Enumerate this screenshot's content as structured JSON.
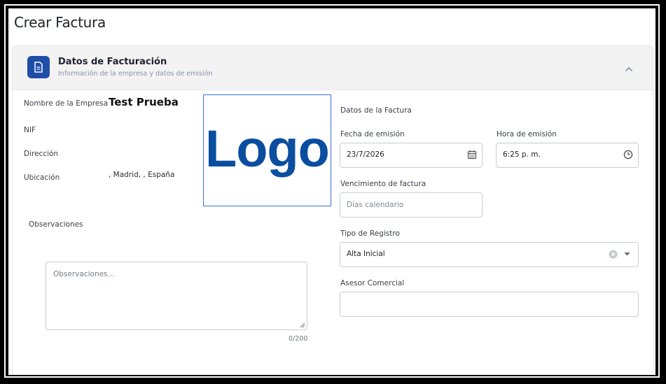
{
  "page": {
    "title": "Crear Factura"
  },
  "section": {
    "title": "Datos de Facturación",
    "subtitle": "Información de la empresa y datos de emisión",
    "icon": "document-icon",
    "collapse_icon": "chevron-up-icon"
  },
  "company": {
    "name_label": "Nombre de la Empresa",
    "name_value": "Test Prueba",
    "nif_label": "NIF",
    "address_label": "Dirección",
    "location_label": "Ubicación",
    "location_value": ", Madrid, , España",
    "logo_text": "Logo"
  },
  "observations": {
    "label": "Observaciones",
    "placeholder": "Observaciones...",
    "counter": "0/200"
  },
  "invoice": {
    "section_label": "Datos de la Factura",
    "issue_date_label": "Fecha de emisión",
    "issue_date_value": "23/7/2026",
    "issue_time_label": "Hora de emisión",
    "issue_time_value": "6:25 p. m.",
    "due_label": "Vencimiento de factura",
    "due_placeholder": "Días calendario",
    "record_type_label": "Tipo de Registro",
    "record_type_value": "Alta Inicial",
    "advisor_label": "Asesor Comercial",
    "advisor_value": ""
  },
  "colors": {
    "accent": "#1f4ea8",
    "logo": "#0a4ea0",
    "header_bg": "#f3f3f4"
  }
}
